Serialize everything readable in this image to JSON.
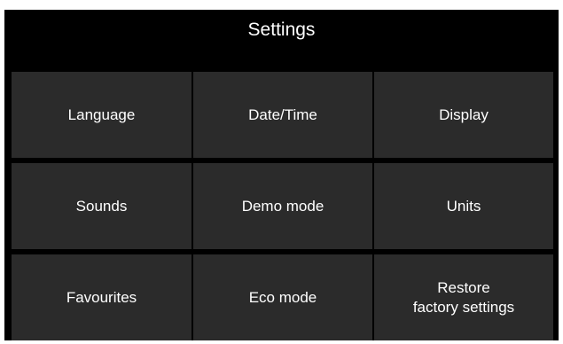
{
  "header": {
    "title": "Settings"
  },
  "menu": {
    "items": [
      {
        "label": "Language"
      },
      {
        "label": "Date/Time"
      },
      {
        "label": "Display"
      },
      {
        "label": "Sounds"
      },
      {
        "label": "Demo mode"
      },
      {
        "label": "Units"
      },
      {
        "label": "Favourites"
      },
      {
        "label": "Eco mode"
      },
      {
        "label": "Restore\nfactory settings"
      }
    ]
  },
  "colors": {
    "background": "#000000",
    "tile": "#2b2b2b",
    "text": "#ffffff"
  }
}
